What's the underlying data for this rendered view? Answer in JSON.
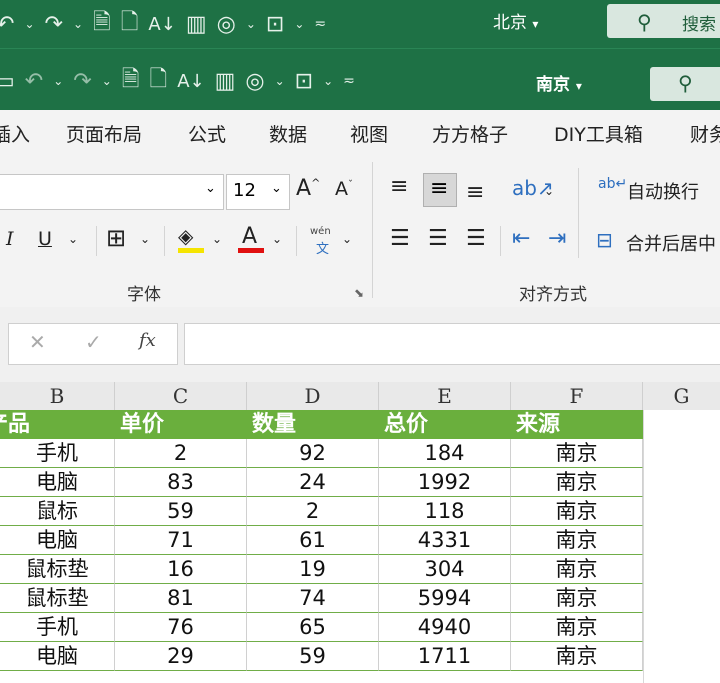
{
  "title_bar": {
    "location_back": "北京",
    "search_back": "搜索",
    "location_front": "南京",
    "dropdown_arrow": "▾"
  },
  "tabs": [
    "插入",
    "页面布局",
    "公式",
    "数据",
    "视图",
    "方方格子",
    "DIY工具箱",
    "财务"
  ],
  "ribbon": {
    "font_size": "12",
    "wrap_text": "自动换行",
    "merge_center": "合并后居中",
    "font_group_label": "字体",
    "align_group_label": "对齐方式",
    "phonetic": "wén"
  },
  "formula_bar": {
    "fx": "fx",
    "cancel": "✕",
    "confirm": "✓",
    "value": ""
  },
  "columns": [
    "B",
    "C",
    "D",
    "E",
    "F",
    "G"
  ],
  "table": {
    "headers": [
      "产品",
      "单价",
      "数量",
      "总价",
      "来源"
    ],
    "rows": [
      [
        "手机",
        "2",
        "92",
        "184",
        "南京"
      ],
      [
        "电脑",
        "83",
        "24",
        "1992",
        "南京"
      ],
      [
        "鼠标",
        "59",
        "2",
        "118",
        "南京"
      ],
      [
        "电脑",
        "71",
        "61",
        "4331",
        "南京"
      ],
      [
        "鼠标垫",
        "16",
        "19",
        "304",
        "南京"
      ],
      [
        "鼠标垫",
        "81",
        "74",
        "5994",
        "南京"
      ],
      [
        "手机",
        "76",
        "65",
        "4940",
        "南京"
      ],
      [
        "电脑",
        "29",
        "59",
        "1711",
        "南京"
      ]
    ]
  },
  "colors": {
    "excel_green": "#1e7145",
    "header_fill": "#6aaf3d",
    "font_color_red": "#e01010",
    "highlight_yellow": "#f5e400"
  }
}
